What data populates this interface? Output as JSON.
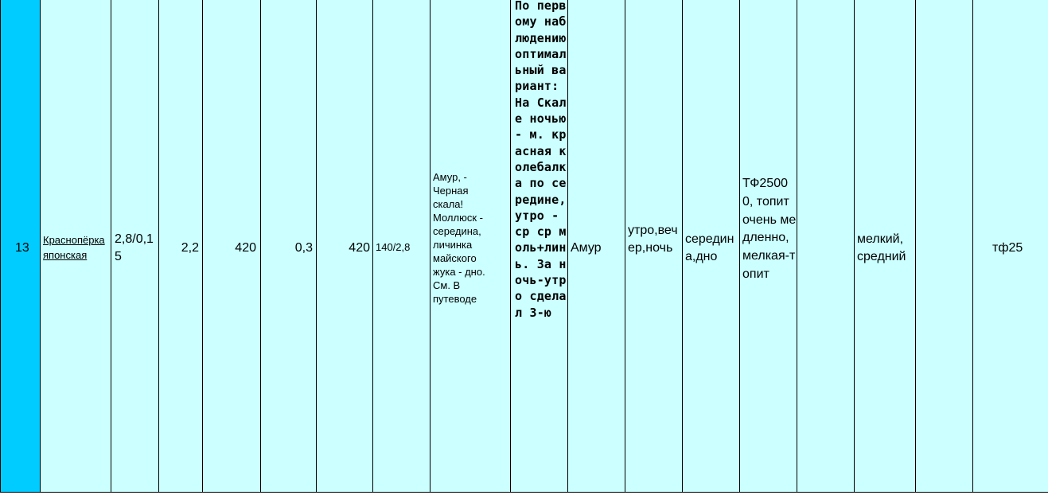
{
  "row": {
    "number": "13",
    "species_link": "Краснопёрка японская",
    "c3": "2,8/0,15",
    "c4": "2,2",
    "c5": "420",
    "c6": "0,3",
    "c7": "420",
    "c8": "140/2,8",
    "c9": "Амур,  - Черная скала! Моллюск - середина, личинка майского жука - дно. См. В путеводе",
    "c10": "По первому наблюдению оптимальный вариант: На Скале ночью - м. красная колебалка по середине, утро - ср ср моль+линь. За ночь-утро сделал 3-ю",
    "c11": "Амур",
    "c12": "утро,вечер,ночь",
    "c13": "середина,дно",
    "c14": "ТФ25000, топит очень медленно, мелкая-топит",
    "c15": "",
    "c16": "мелкий, средний",
    "c17": "",
    "c18": "тф25"
  },
  "colors": {
    "row_bg": "#ccffff",
    "number_bg": "#00ccff",
    "link": "#0000ee"
  }
}
